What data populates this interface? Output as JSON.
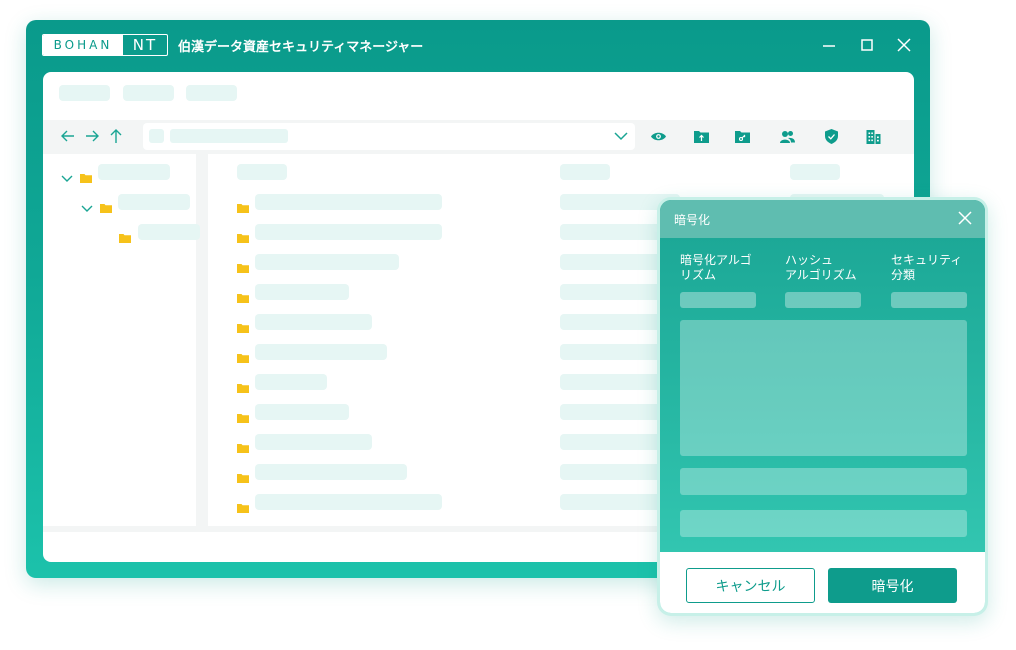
{
  "window": {
    "logo_left": "BOHAN",
    "logo_right": "NT",
    "title": "伯漢データ資産セキュリティマネージャー",
    "accent_color": "#0a9a8b",
    "controls": [
      "minimize-icon",
      "maximize-icon",
      "close-icon"
    ]
  },
  "toolbar": {
    "nav_icons": [
      "arrow-left-icon",
      "arrow-right-icon",
      "arrow-up-icon"
    ],
    "action_icons": [
      "eye-icon",
      "folder-upload-icon",
      "folder-key-icon",
      "users-icon",
      "shield-check-icon",
      "building-icon"
    ]
  },
  "folder_icon_color": "#f6c21a",
  "dialog": {
    "title": "暗号化",
    "labels": {
      "encryption_algorithm": "暗号化アルゴ\nリズム",
      "hash_algorithm": "ハッシュ\nアルゴリズム",
      "security_class": "セキュリティ\n分類"
    },
    "cancel_label": "キャンセル",
    "encrypt_label": "暗号化"
  }
}
